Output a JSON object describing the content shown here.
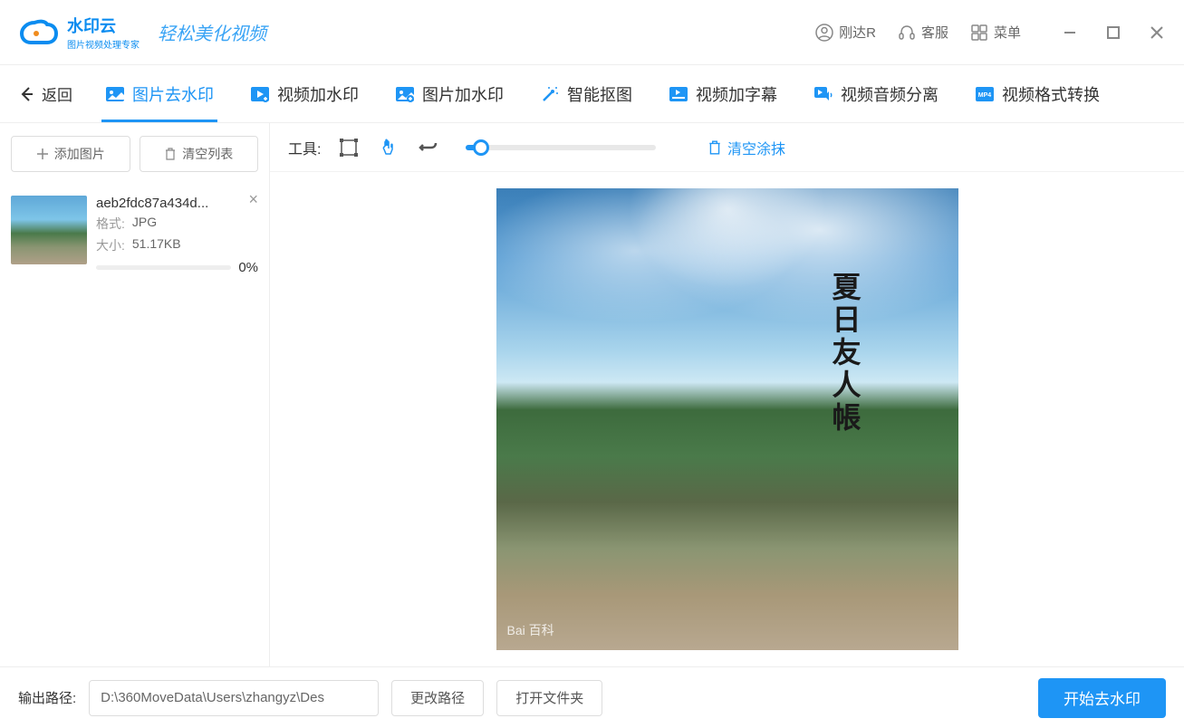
{
  "header": {
    "logo_title": "水印云",
    "logo_sub": "图片视频处理专家",
    "tagline": "轻松美化视频",
    "user_label": "刚达R",
    "support_label": "客服",
    "menu_label": "菜单"
  },
  "tabs": {
    "back": "返回",
    "items": [
      {
        "label": "图片去水印"
      },
      {
        "label": "视频加水印"
      },
      {
        "label": "图片加水印"
      },
      {
        "label": "智能抠图"
      },
      {
        "label": "视频加字幕"
      },
      {
        "label": "视频音频分离"
      },
      {
        "label": "视频格式转换"
      }
    ]
  },
  "sidebar": {
    "add_image": "添加图片",
    "clear_list": "清空列表",
    "file": {
      "name": "aeb2fdc87a434d...",
      "format_label": "格式:",
      "format_value": "JPG",
      "size_label": "大小:",
      "size_value": "51.17KB",
      "progress": "0%"
    }
  },
  "toolbar": {
    "label": "工具:",
    "clear_brush": "清空涂抹"
  },
  "canvas": {
    "image_title": "夏日友人帳",
    "watermark": "Bai 百科"
  },
  "footer": {
    "path_label": "输出路径:",
    "path_value": "D:\\360MoveData\\Users\\zhangyz\\Des",
    "change_path": "更改路径",
    "open_folder": "打开文件夹",
    "start": "开始去水印"
  },
  "colors": {
    "primary": "#1e95f5"
  }
}
